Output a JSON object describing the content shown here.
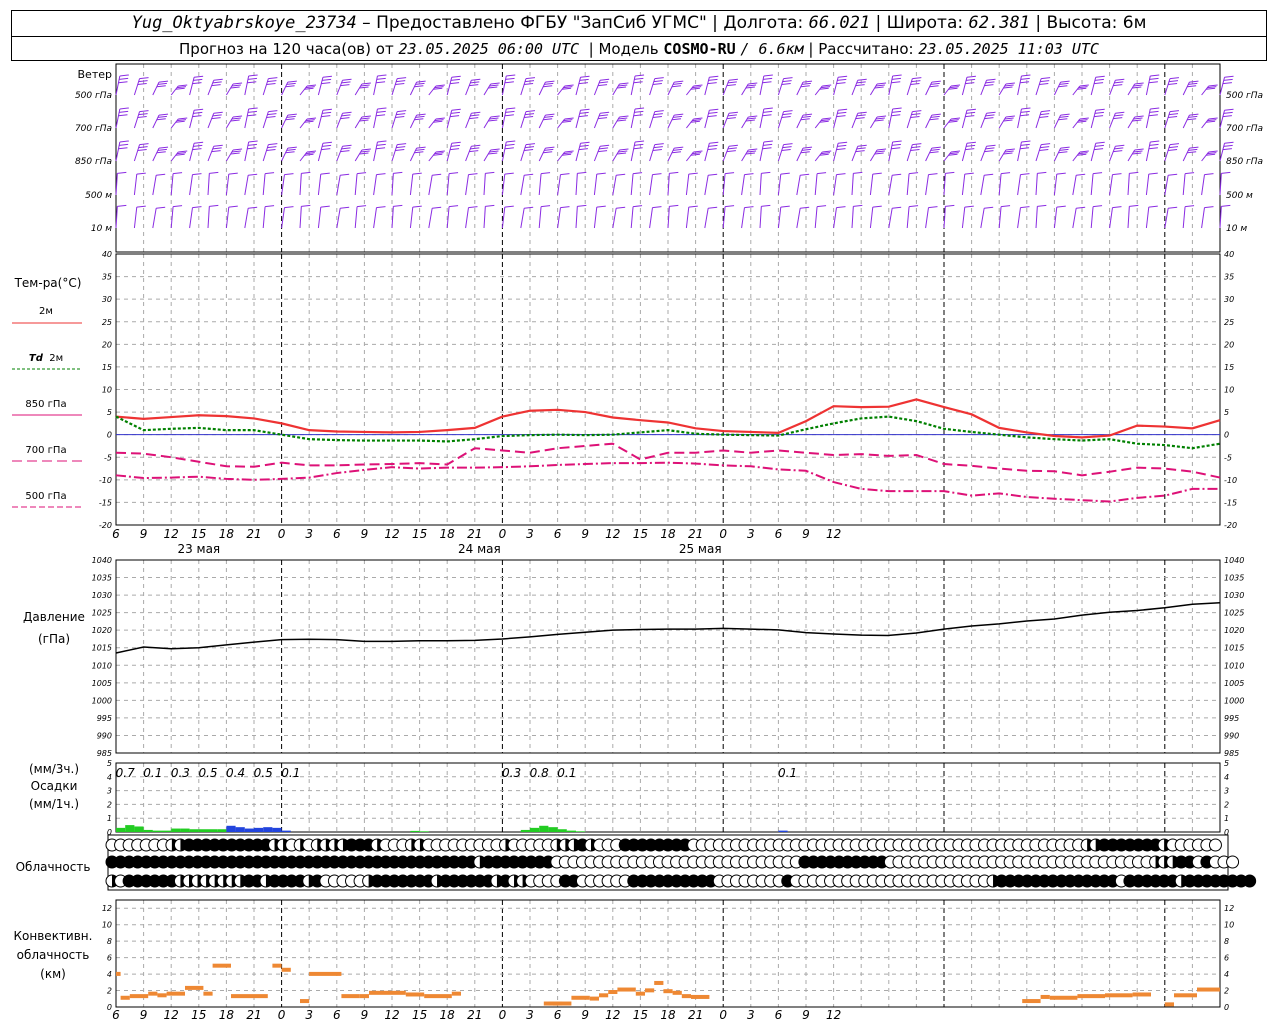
{
  "header": {
    "station": "Yug_Oktyabrskoye_23734",
    "sep1": " – ",
    "provided": "Предоставлено ФГБУ \"ЗапСиб УГМС\"",
    "lon_label": "Долгота:",
    "lon": "66.021",
    "lat_label": "Широта:",
    "lat": "62.381",
    "alt_label": "Высота:",
    "alt": "6м",
    "forecast_prefix": "Прогноз на 120 часа(ов) от",
    "forecast_from": "23.05.2025 06:00 UTC",
    "model_label": "Модель",
    "model": "COSMO-RU",
    "model_res": "/ 6.6км",
    "calc_label": "Рассчитано:",
    "calc_time": "23.05.2025 11:03 UTC"
  },
  "labels": {
    "wind": "Ветер",
    "wind_levels": [
      "500 гПа",
      "700 гПа",
      "850 гПа",
      "500 м",
      "10  м"
    ],
    "temp_title": "Тем-ра(°C)",
    "temp_2m": "2м",
    "td_2m_a": "Td",
    "td_2m_b": "2м",
    "t850": "850 гПа",
    "t700": "700 гПа",
    "t500": "500 гПа",
    "pressure_a": "Давление",
    "pressure_b": "(гПа)",
    "precip_a": "(мм/3ч.)",
    "precip_b": "Осадки",
    "precip_c": "(мм/1ч.)",
    "cloud": "Облачность",
    "conv_a": "Конвективн.",
    "conv_b": "облачность",
    "conv_c": "(км)"
  },
  "colors": {
    "t2m": "#ee3333",
    "td2m": "#008000",
    "t850": "#dd1177",
    "t700": "#dd1177",
    "t500": "#dd1177",
    "wind": "#8a2be2",
    "precip_green": "#22cc22",
    "precip_blue": "#2244dd",
    "conv": "#ee8833",
    "zero_line": "#3333cc"
  },
  "chart_data": [
    {
      "type": "line",
      "name": "temperature",
      "x_hours": [
        0,
        3,
        6,
        9,
        12,
        15,
        18,
        21,
        24,
        27,
        30,
        33,
        36,
        39,
        42,
        45,
        48,
        51,
        54,
        57,
        60,
        63,
        66,
        69,
        72,
        75,
        78,
        81,
        84,
        87,
        90,
        93,
        96,
        99,
        102,
        105,
        108,
        111,
        114,
        117,
        120
      ],
      "ylim": [
        -20,
        40
      ],
      "yticks": [
        -20,
        -15,
        -10,
        -5,
        0,
        5,
        10,
        15,
        20,
        25,
        30,
        35,
        40
      ],
      "series": [
        {
          "key": "t2m",
          "values": [
            4,
            3.5,
            3.9,
            4.3,
            4.1,
            3.6,
            2.5,
            1,
            0.7,
            0.6,
            0.5,
            0.6,
            1,
            1.5,
            4,
            5.3,
            5.5,
            5,
            3.8,
            3.2,
            2.7,
            1.4,
            0.8,
            0.6,
            0.4,
            3,
            6.3,
            6.1,
            6.2,
            7.8,
            6.1,
            4.5,
            1.5,
            0.5,
            -0.3,
            -0.6,
            -0.2,
            2,
            1.8,
            1.4,
            3.2
          ]
        },
        {
          "key": "td2m",
          "values": [
            4,
            1,
            1.3,
            1.5,
            1,
            1,
            0,
            -1,
            -1.2,
            -1.3,
            -1.3,
            -1.3,
            -1.5,
            -1,
            -0.3,
            -0.1,
            0,
            -0.1,
            0,
            0.5,
            1,
            0.2,
            0,
            -0.1,
            -0.2,
            1.2,
            2.5,
            3.6,
            4,
            3,
            1.3,
            0.6,
            0,
            -0.6,
            -1,
            -1.3,
            -1,
            -2,
            -2.3,
            -3,
            -2
          ]
        },
        {
          "key": "t850",
          "values": [
            -4,
            -4.2,
            -5,
            -6,
            -7,
            -7.1,
            -6.2,
            -6.8,
            -6.8,
            -6.6,
            -6.5,
            -6.3,
            -6.6,
            -3,
            -3.5,
            -4,
            -3,
            -2.5,
            -2,
            -5.5,
            -4,
            -4,
            -3.5,
            -4,
            -3.5,
            -4,
            -4.5,
            -4.3,
            -4.7,
            -4.5,
            -6.5,
            -6.9,
            -7.5,
            -8,
            -8.1,
            -9,
            -8.2,
            -7.3,
            -7.5,
            -8.2,
            -9.5
          ]
        },
        {
          "key": "t500",
          "values": [
            -9,
            -9.6,
            -9.5,
            -9.3,
            -9.8,
            -10,
            -9.8,
            -9.5,
            -8.5,
            -7.8,
            -7.2,
            -7.5,
            -7.3,
            -7.3,
            -7.2,
            -7,
            -6.7,
            -6.5,
            -6.3,
            -6.3,
            -6.2,
            -6.4,
            -6.8,
            -7,
            -7.7,
            -8,
            -10.5,
            -12,
            -12.5,
            -12.5,
            -12.5,
            -13.5,
            -13,
            -13.8,
            -14.2,
            -14.5,
            -14.8,
            -14,
            -13.5,
            -12,
            -12
          ]
        }
      ]
    },
    {
      "type": "line",
      "name": "pressure",
      "x_hours": [
        0,
        3,
        6,
        9,
        12,
        15,
        18,
        21,
        24,
        27,
        30,
        33,
        36,
        39,
        42,
        45,
        48,
        51,
        54,
        57,
        60,
        63,
        66,
        69,
        72,
        75,
        78,
        81,
        84,
        87,
        90,
        93,
        96,
        99,
        102,
        105,
        108,
        111,
        114,
        117,
        120
      ],
      "ylim": [
        985,
        1040
      ],
      "yticks": [
        985,
        990,
        995,
        1000,
        1005,
        1010,
        1015,
        1020,
        1025,
        1030,
        1035,
        1040
      ],
      "values": [
        1013.5,
        1015.2,
        1014.7,
        1015,
        1015.8,
        1016.6,
        1017.3,
        1017.4,
        1017.3,
        1016.8,
        1016.8,
        1017,
        1017,
        1017.1,
        1017.5,
        1018.1,
        1018.8,
        1019.4,
        1020,
        1020.2,
        1020.3,
        1020.3,
        1020.5,
        1020.3,
        1020.1,
        1019.3,
        1018.9,
        1018.6,
        1018.5,
        1019.2,
        1020.3,
        1021.2,
        1021.8,
        1022.6,
        1023.2,
        1024.3,
        1025.1,
        1025.6,
        1026.4,
        1027.4,
        1027.8
      ]
    },
    {
      "type": "bar",
      "name": "precipitation",
      "ylim": [
        0,
        5
      ],
      "yticks": [
        0,
        1,
        2,
        3,
        4,
        5
      ],
      "totals_3h": [
        {
          "hour": 1,
          "text": "0.7"
        },
        {
          "hour": 4,
          "text": "0.1"
        },
        {
          "hour": 7,
          "text": "0.3"
        },
        {
          "hour": 10,
          "text": "0.5"
        },
        {
          "hour": 13,
          "text": "0.4"
        },
        {
          "hour": 16,
          "text": "0.5"
        },
        {
          "hour": 19,
          "text": "0.1"
        },
        {
          "hour": 43,
          "text": "0.3"
        },
        {
          "hour": 46,
          "text": "0.8"
        },
        {
          "hour": 49,
          "text": "0.1"
        },
        {
          "hour": 73,
          "text": "0.1"
        }
      ],
      "hourly": [
        {
          "h": 0,
          "v": 0.3,
          "c": "g"
        },
        {
          "h": 1,
          "v": 0.5,
          "c": "g"
        },
        {
          "h": 2,
          "v": 0.4,
          "c": "g"
        },
        {
          "h": 3,
          "v": 0.15,
          "c": "g"
        },
        {
          "h": 4,
          "v": 0.1,
          "c": "g"
        },
        {
          "h": 5,
          "v": 0.1,
          "c": "g"
        },
        {
          "h": 6,
          "v": 0.25,
          "c": "g"
        },
        {
          "h": 7,
          "v": 0.25,
          "c": "g"
        },
        {
          "h": 8,
          "v": 0.2,
          "c": "g"
        },
        {
          "h": 9,
          "v": 0.2,
          "c": "g"
        },
        {
          "h": 10,
          "v": 0.2,
          "c": "g"
        },
        {
          "h": 11,
          "v": 0.2,
          "c": "g"
        },
        {
          "h": 12,
          "v": 0.45,
          "c": "b"
        },
        {
          "h": 13,
          "v": 0.35,
          "c": "b"
        },
        {
          "h": 14,
          "v": 0.25,
          "c": "b"
        },
        {
          "h": 15,
          "v": 0.3,
          "c": "b"
        },
        {
          "h": 16,
          "v": 0.35,
          "c": "b"
        },
        {
          "h": 17,
          "v": 0.3,
          "c": "b"
        },
        {
          "h": 18,
          "v": 0.1,
          "c": "b"
        },
        {
          "h": 32,
          "v": 0.08,
          "c": "g"
        },
        {
          "h": 33,
          "v": 0.05,
          "c": "g"
        },
        {
          "h": 44,
          "v": 0.15,
          "c": "g"
        },
        {
          "h": 45,
          "v": 0.3,
          "c": "g"
        },
        {
          "h": 46,
          "v": 0.45,
          "c": "g"
        },
        {
          "h": 47,
          "v": 0.35,
          "c": "g"
        },
        {
          "h": 48,
          "v": 0.2,
          "c": "g"
        },
        {
          "h": 49,
          "v": 0.1,
          "c": "g"
        },
        {
          "h": 50,
          "v": 0.05,
          "c": "g"
        },
        {
          "h": 72,
          "v": 0.1,
          "c": "b"
        }
      ]
    },
    {
      "type": "table",
      "name": "cloudiness",
      "rows": [
        "0000000112222222222330303333222300031000000000300000333230002222222200000000000000000000000000000000000000000000003322222223000000",
        "222222222222222222222222222222222222222222232222222200000000000000000000000000000222222222200000000000000000000000000000001112202000",
        "30222222313331332232222320000032222222322222232330000220000002222222222000000002000000000000000000000003222222222222220222222322222222"
      ]
    },
    {
      "type": "bar",
      "name": "convective_cloud",
      "ylim": [
        0,
        13
      ],
      "yticks": [
        0,
        2,
        4,
        6,
        8,
        10,
        12
      ],
      "segments": [
        {
          "h0": 0,
          "h1": 0.5,
          "v": 3.9
        },
        {
          "h0": 0.5,
          "h1": 1.5,
          "v": 1
        },
        {
          "h0": 1.5,
          "h1": 3.5,
          "v": 1.2
        },
        {
          "h0": 3.5,
          "h1": 4.5,
          "v": 1.5
        },
        {
          "h0": 4.5,
          "h1": 5.5,
          "v": 1.3
        },
        {
          "h0": 5.5,
          "h1": 7.5,
          "v": 1.5
        },
        {
          "h0": 7.5,
          "h1": 9.5,
          "v": 2.2
        },
        {
          "h0": 9.5,
          "h1": 10.5,
          "v": 1.5
        },
        {
          "h0": 10.5,
          "h1": 12.5,
          "v": 4.9
        },
        {
          "h0": 12.5,
          "h1": 16.5,
          "v": 1.2
        },
        {
          "h0": 17,
          "h1": 18,
          "v": 4.9
        },
        {
          "h0": 18,
          "h1": 19,
          "v": 4.4
        },
        {
          "h0": 20,
          "h1": 21,
          "v": 0.6
        },
        {
          "h0": 21,
          "h1": 24.5,
          "v": 3.9
        },
        {
          "h0": 24.5,
          "h1": 26.5,
          "v": 1.2
        },
        {
          "h0": 26.5,
          "h1": 27.5,
          "v": 1.2
        },
        {
          "h0": 27.5,
          "h1": 31.5,
          "v": 1.6
        },
        {
          "h0": 31.5,
          "h1": 33.5,
          "v": 1.4
        },
        {
          "h0": 33.5,
          "h1": 36.5,
          "v": 1.2
        },
        {
          "h0": 36.5,
          "h1": 37.5,
          "v": 1.5
        },
        {
          "h0": 47,
          "h1": 48,
          "v": 0.3
        },
        {
          "h0": 46.5,
          "h1": 48.5,
          "v": 0.3
        },
        {
          "h0": 47.5,
          "h1": 48,
          "v": 0.3
        },
        {
          "h0": 47.5,
          "h1": 49.5,
          "v": 0.3
        },
        {
          "h0": 49.5,
          "h1": 51.5,
          "v": 1
        },
        {
          "h0": 51.5,
          "h1": 52.5,
          "v": 0.9
        },
        {
          "h0": 52.5,
          "h1": 53.5,
          "v": 1.3
        },
        {
          "h0": 53.5,
          "h1": 54.5,
          "v": 1.7
        },
        {
          "h0": 54.5,
          "h1": 56.5,
          "v": 2
        },
        {
          "h0": 56.5,
          "h1": 57.5,
          "v": 1.5
        },
        {
          "h0": 57.5,
          "h1": 58.5,
          "v": 1.9
        },
        {
          "h0": 58.5,
          "h1": 59.5,
          "v": 2.8
        },
        {
          "h0": 59.5,
          "h1": 60.5,
          "v": 1.8
        },
        {
          "h0": 60.5,
          "h1": 61.5,
          "v": 1.6
        },
        {
          "h0": 61.5,
          "h1": 62.5,
          "v": 1.2
        },
        {
          "h0": 62.5,
          "h1": 64.5,
          "v": 1.1
        },
        {
          "h0": 98.5,
          "h1": 100.5,
          "v": 0.6
        },
        {
          "h0": 100.5,
          "h1": 101.5,
          "v": 1.1
        },
        {
          "h0": 101.5,
          "h1": 104.5,
          "v": 1
        },
        {
          "h0": 104.5,
          "h1": 107.5,
          "v": 1.2
        },
        {
          "h0": 107.5,
          "h1": 110.5,
          "v": 1.3
        },
        {
          "h0": 110.5,
          "h1": 112.5,
          "v": 1.4
        },
        {
          "h0": 114,
          "h1": 115,
          "v": 0.2
        },
        {
          "h0": 115,
          "h1": 117.5,
          "v": 1.3
        },
        {
          "h0": 117.5,
          "h1": 120,
          "v": 2
        }
      ]
    }
  ],
  "x_axis": {
    "tick_labels": [
      "6",
      "9",
      "12",
      "15",
      "18",
      "21",
      "0",
      "3",
      "6",
      "9",
      "12",
      "15",
      "18",
      "21",
      "0",
      "3",
      "6",
      "9",
      "12",
      "15",
      "18",
      "21",
      "0",
      "3",
      "6",
      "9",
      "12"
    ],
    "days": [
      "23 мая",
      "24 мая",
      "25 мая"
    ]
  }
}
